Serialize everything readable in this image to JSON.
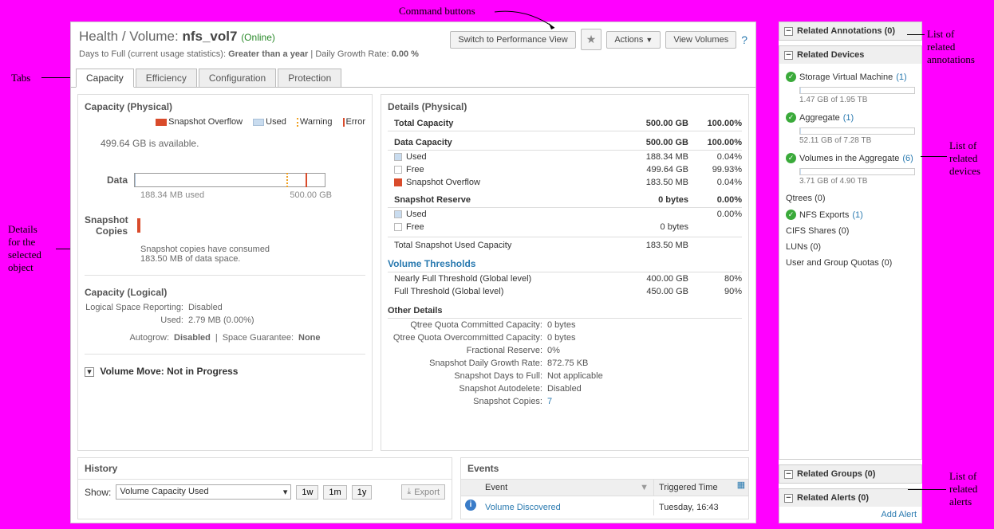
{
  "header": {
    "breadcrumb_pre": "Health / Volume: ",
    "volume_name": "nfs_vol7",
    "status": "(Online)",
    "sub_a": "Days to Full (current usage statistics): ",
    "sub_a_val": "Greater than a year",
    "sub_sep": " | ",
    "sub_b": "Daily Growth Rate: ",
    "sub_b_val": "0.00 %",
    "btn_perf": "Switch to Performance View",
    "btn_actions": "Actions",
    "btn_view_vol": "View Volumes"
  },
  "tabs": [
    "Capacity",
    "Efficiency",
    "Configuration",
    "Protection"
  ],
  "cap_phys": {
    "title": "Capacity (Physical)",
    "legend": {
      "snap": "Snapshot Overflow",
      "used": "Used",
      "warn": "Warning",
      "err": "Error"
    },
    "avail": "499.64 GB is available.",
    "data_label": "Data",
    "data_used": "188.34 MB used",
    "data_total": "500.00 GB",
    "snap_label": "Snapshot\nCopies",
    "snap_text1": "Snapshot copies have consumed",
    "snap_text2": "183.50 MB of data space."
  },
  "cap_log": {
    "title": "Capacity (Logical)",
    "lsr_k": "Logical Space Reporting:",
    "lsr_v": "Disabled",
    "used_k": "Used:",
    "used_v": "2.79 MB (0.00%)",
    "autogrow_pre": "Autogrow: ",
    "autogrow_v": "Disabled",
    "sep": "|",
    "sg_pre": "Space Guarantee: ",
    "sg_v": "None",
    "vm_label": "Volume Move: Not in Progress"
  },
  "details": {
    "title": "Details (Physical)",
    "rows": [
      {
        "sec": true,
        "label": "Total Capacity",
        "v1": "500.00 GB",
        "v2": "100.00%"
      },
      {
        "sec": true,
        "label": "Data Capacity",
        "v1": "500.00 GB",
        "v2": "100.00%"
      },
      {
        "sq": "blue",
        "label": "Used",
        "v1": "188.34 MB",
        "v2": "0.04%"
      },
      {
        "sq": "white",
        "label": "Free",
        "v1": "499.64 GB",
        "v2": "99.93%"
      },
      {
        "sq": "red",
        "label": "Snapshot Overflow",
        "v1": "183.50 MB",
        "v2": "0.04%"
      },
      {
        "sec": true,
        "label": "Snapshot Reserve",
        "v1": "0 bytes",
        "v2": "0.00%"
      },
      {
        "sq": "blue",
        "label": "Used",
        "v1": "",
        "v2": "0.00%"
      },
      {
        "sq": "white",
        "label": "Free",
        "v1": "0 bytes",
        "v2": ""
      },
      {
        "plain": true,
        "label": "Total Snapshot Used Capacity",
        "v1": "183.50 MB",
        "v2": ""
      }
    ],
    "vt_link": "Volume Thresholds",
    "vt_rows": [
      {
        "label": "Nearly Full Threshold (Global level)",
        "v1": "400.00 GB",
        "v2": "80%"
      },
      {
        "label": "Full Threshold (Global level)",
        "v1": "450.00 GB",
        "v2": "90%"
      }
    ],
    "other_title": "Other Details",
    "other": [
      {
        "k": "Qtree Quota Committed Capacity:",
        "v": "0 bytes"
      },
      {
        "k": "Qtree Quota Overcommitted Capacity:",
        "v": "0 bytes"
      },
      {
        "k": "Fractional Reserve:",
        "v": "0%"
      },
      {
        "k": "Snapshot Daily Growth Rate:",
        "v": "872.75 KB"
      },
      {
        "k": "Snapshot Days to Full:",
        "v": "Not applicable"
      },
      {
        "k": "Snapshot Autodelete:",
        "v": "Disabled"
      },
      {
        "k": "Snapshot Copies:",
        "v": "7",
        "link": true
      }
    ]
  },
  "history": {
    "title": "History",
    "show_label": "Show:",
    "selected": "Volume Capacity Used",
    "r1": "1w",
    "r2": "1m",
    "r3": "1y",
    "export": "Export"
  },
  "events": {
    "title": "Events",
    "col_event": "Event",
    "col_time": "Triggered Time",
    "row1_name": "Volume Discovered",
    "row1_time": "Tuesday, 16:43"
  },
  "side": {
    "annot_title": "Related Annotations (0)",
    "devices_title": "Related Devices",
    "svm_label": "Storage Virtual Machine",
    "svm_cnt": "(1)",
    "svm_usage": "1.47 GB of 1.95 TB",
    "agg_label": "Aggregate",
    "agg_cnt": "(1)",
    "agg_usage": "52.11 GB of 7.28 TB",
    "via_label": "Volumes in the Aggregate",
    "via_cnt": "(6)",
    "via_usage": "3.71 GB of 4.90 TB",
    "qtrees": "Qtrees (0)",
    "nfs_label": "NFS Exports",
    "nfs_cnt": "(1)",
    "cifs": "CIFS Shares (0)",
    "luns": "LUNs (0)",
    "ugq": "User and Group Quotas (0)",
    "groups_title": "Related Groups (0)",
    "alerts_title": "Related Alerts (0)",
    "add_alert": "Add Alert"
  },
  "annotations": {
    "command_buttons": "Command buttons",
    "tabs": "Tabs",
    "details": "Details\nfor the\nselected\nobject",
    "rel_annot": "List of\nrelated\nannotations",
    "rel_dev": "List of\nrelated\ndevices",
    "rel_alerts": "List of\nrelated\nalerts"
  },
  "chart_data": {
    "type": "bar",
    "title": "Data capacity usage",
    "series": [
      {
        "name": "Used",
        "label": "188.34 MB",
        "bytes": 197525504
      },
      {
        "name": "Total",
        "label": "500.00 GB",
        "bytes": 536870912000
      }
    ],
    "thresholds": {
      "warning_pct": 80,
      "error_pct": 90
    }
  }
}
